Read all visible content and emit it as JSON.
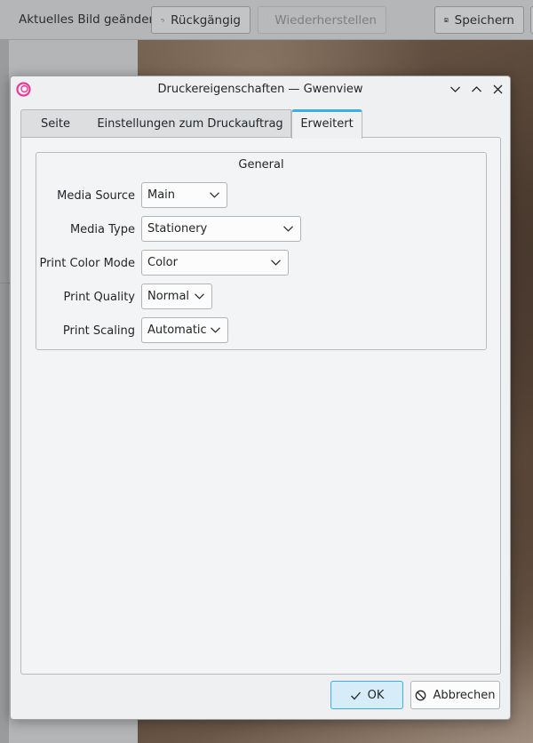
{
  "background_app": {
    "status_text": "Aktuelles Bild geändert",
    "undo_label": "Rückgängig",
    "redo_label": "Wiederherstellen",
    "save_label": "Speichern"
  },
  "dialog": {
    "title": "Druckereigenschaften — Gwenview",
    "tabs": [
      {
        "label": "Seite",
        "active": false
      },
      {
        "label": "Einstellungen zum Druckauftrag",
        "active": false
      },
      {
        "label": "Erweitert",
        "active": true
      }
    ],
    "group": {
      "title": "General",
      "rows": [
        {
          "label": "Media Source",
          "value": "Main"
        },
        {
          "label": "Media Type",
          "value": "Stationery"
        },
        {
          "label": "Print Color Mode",
          "value": "Color"
        },
        {
          "label": "Print Quality",
          "value": "Normal"
        },
        {
          "label": "Print Scaling",
          "value": "Automatic"
        }
      ]
    },
    "buttons": {
      "ok_label": "OK",
      "cancel_label": "Abbrechen"
    }
  },
  "colors": {
    "accent": "#3daee9",
    "app_icon": "#e93a9a"
  }
}
